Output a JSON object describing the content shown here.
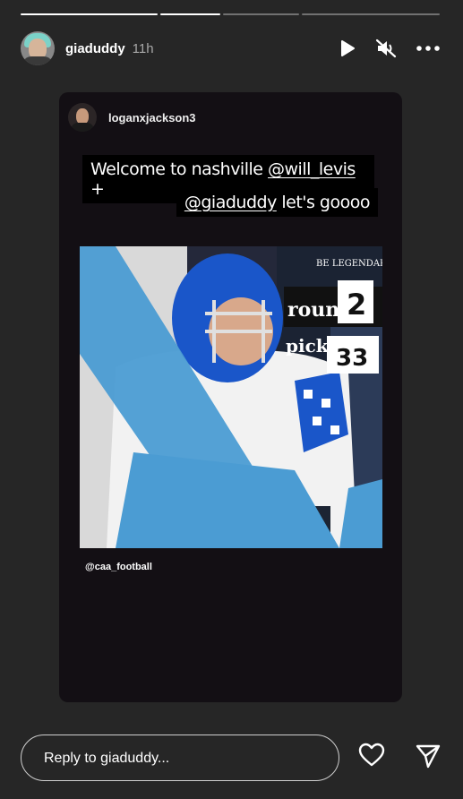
{
  "story": {
    "progress": [
      1,
      1,
      0,
      0
    ],
    "user": {
      "name": "giaduddy",
      "time": "11h"
    },
    "icons": {
      "play": "play-icon",
      "mute": "muted-speaker-icon",
      "more": "more-options-icon"
    }
  },
  "repost": {
    "username": "loganxjackson3",
    "caption": {
      "line1_text": "Welcome to nashville ",
      "line1_mention": "@will_levis",
      "line1_tail": " +",
      "line2_mention": "@giaduddy",
      "line2_text": " let's goooo"
    },
    "graphic": {
      "be_legendary": "BE LEGENDARY",
      "round_label": "round",
      "round_value": "2",
      "pick_label": "pick",
      "pick_value": "33"
    },
    "credit": "@caa_football"
  },
  "footer": {
    "reply_placeholder": "Reply to giaduddy...",
    "icons": [
      "heart-icon",
      "send-icon"
    ]
  },
  "colors": {
    "background": "#262626",
    "story_card": "#130f14",
    "uk_blue": "#1a56c9",
    "titans_light_blue": "#4b9cd3"
  }
}
